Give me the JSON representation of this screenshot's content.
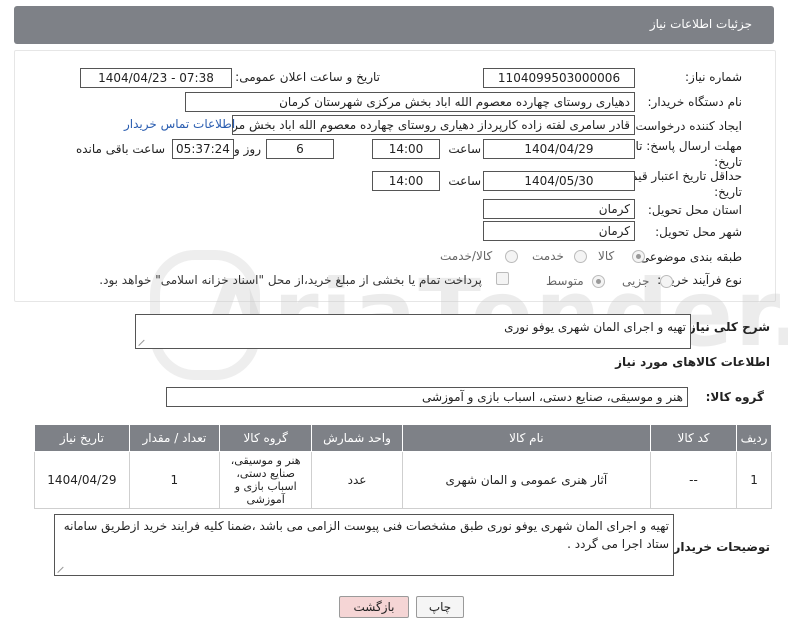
{
  "header": {
    "title": "جزئیات اطلاعات نیاز"
  },
  "fields": {
    "need_number_label": "شماره نیاز:",
    "need_number": "1104099503000006",
    "announce_label": "تاریخ و ساعت اعلان عمومی:",
    "announce_value": "1404/04/23 - 07:38",
    "buyer_org_label": "نام دستگاه خریدار:",
    "buyer_org": "دهیاری روستای چهارده معصوم الله اباد بخش مرکزی شهرستان کرمان",
    "creator_label": "ایجاد کننده درخواست:",
    "creator": "قادر سامری لفته زاده کارپرداز دهیاری روستای چهارده معصوم الله اباد بخش مرکزی",
    "contact_link": "اطلاعات تماس خریدار",
    "deadline_label": "مهلت ارسال پاسخ: تا تاریخ:",
    "deadline_date": "1404/04/29",
    "time_label": "ساعت",
    "deadline_time": "14:00",
    "days": "6",
    "days_label": "روز و",
    "remaining_time": "05:37:24",
    "remaining_label": "ساعت باقی مانده",
    "min_price_label": "حداقل تاریخ اعتبار قیمت: تا تاریخ:",
    "price_date": "1404/05/30",
    "price_time": "14:00",
    "province_label": "استان محل تحویل:",
    "province": "کرمان",
    "city_label": "شهر محل تحویل:",
    "city": "کرمان",
    "category_label": "طبقه بندی موضوعی:",
    "cat_options": [
      "کالا",
      "خدمت",
      "کالا/خدمت"
    ],
    "process_label": "نوع فرآیند خرید :",
    "process_options": [
      "جزیی",
      "متوسط"
    ],
    "payment_note": "پرداخت تمام یا بخشی از مبلغ خرید،از محل \"اسناد خزانه اسلامی\" خواهد بود."
  },
  "summary": {
    "label": "شرح کلی نیاز:",
    "value": "تهیه و اجرای المان شهری یوفو نوری"
  },
  "goods_section": {
    "title": "اطلاعات کالاهای مورد نیاز",
    "group_label": "گروه کالا:",
    "group_value": "هنر و موسیقی، صنایع دستی، اسباب بازی و آموزشی"
  },
  "table": {
    "headers": [
      "ردیف",
      "کد کالا",
      "نام کالا",
      "واحد شمارش",
      "گروه کالا",
      "تعداد / مقدار",
      "تاریخ نیاز"
    ],
    "rows": [
      [
        "1",
        "--",
        "آثار هنری عمومی و المان شهری",
        "عدد",
        "هنر و موسیقی، صنایع دستی، اسباب بازی و آموزشی",
        "1",
        "1404/04/29"
      ]
    ]
  },
  "buyer_notes": {
    "label": "توضیحات خریدار:",
    "value": "تهیه و اجرای المان شهری یوفو نوری طبق مشخصات فنی پیوست الزامی می باشد ،ضمنا کلیه فرایند خرید ازطریق سامانه ستاد اجرا می گردد ."
  },
  "buttons": {
    "print": "چاپ",
    "back": "بازگشت"
  },
  "watermark": "AriaTender.neT",
  "colors": {
    "header": "#7e8187",
    "link": "#2a5db0",
    "back_btn": "#f5d5d5"
  }
}
